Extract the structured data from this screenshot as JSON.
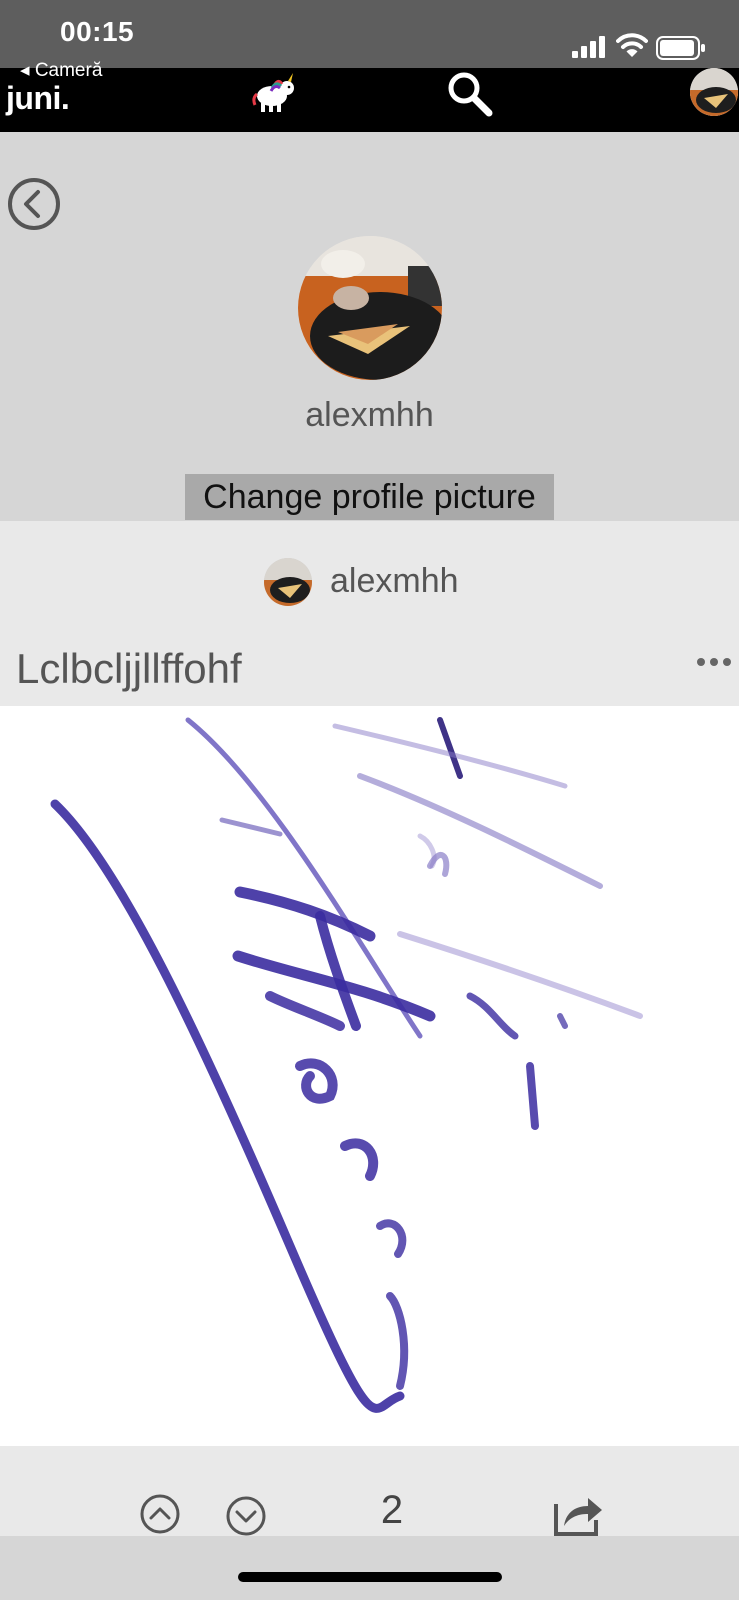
{
  "status_bar": {
    "time": "00:15",
    "icons": [
      "signal-icon",
      "wifi-icon",
      "battery-icon"
    ]
  },
  "header": {
    "back_label": "◂ Cameră",
    "logo": "juni.",
    "icons": [
      "unicorn-icon",
      "search-icon",
      "avatar"
    ]
  },
  "profile": {
    "username": "alexmhh",
    "change_picture_label": "Change profile picture"
  },
  "post": {
    "author": "alexmhh",
    "title": "Lclbcljjllffohf",
    "votes": "2"
  },
  "colors": {
    "status_bar": "#5e5e5e",
    "header": "#000000",
    "background": "#d6d6d6",
    "card": "#e9e9e9",
    "button_highlight": "#a9a9a9",
    "ink": "#3b2ca0"
  }
}
